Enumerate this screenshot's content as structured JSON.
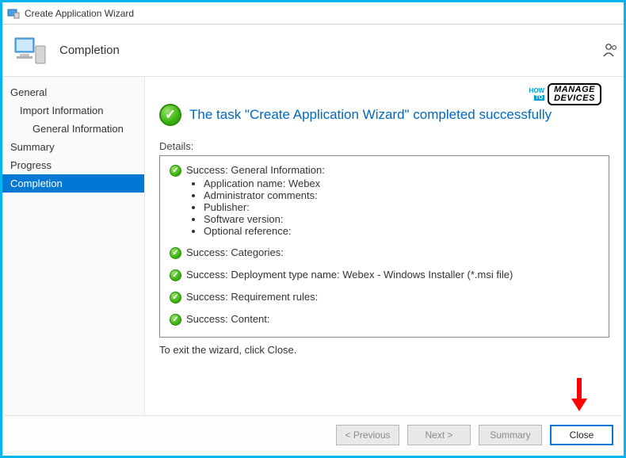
{
  "titlebar": {
    "title": "Create Application Wizard"
  },
  "header": {
    "title": "Completion"
  },
  "watermark": {
    "how": "HOW",
    "to": "TO",
    "brand": "MANAGE DEVICES"
  },
  "sidebar": {
    "items": [
      {
        "label": "General",
        "indent": 0
      },
      {
        "label": "Import Information",
        "indent": 1
      },
      {
        "label": "General Information",
        "indent": 2
      },
      {
        "label": "Summary",
        "indent": 0
      },
      {
        "label": "Progress",
        "indent": 0
      },
      {
        "label": "Completion",
        "indent": 0,
        "selected": true
      }
    ]
  },
  "status": {
    "message": "The task \"Create Application Wizard\" completed successfully"
  },
  "details": {
    "label": "Details:",
    "sections": [
      {
        "title": "Success: General Information:",
        "bullets": [
          "Application name: Webex",
          "Administrator comments:",
          "Publisher:",
          "Software version:",
          "Optional reference:"
        ]
      },
      {
        "title": "Success: Categories:"
      },
      {
        "title": "Success: Deployment type name: Webex - Windows Installer (*.msi file)"
      },
      {
        "title": "Success: Requirement rules:"
      },
      {
        "title": "Success: Content:"
      }
    ]
  },
  "exit_hint": "To exit the wizard, click Close.",
  "footer": {
    "previous": "< Previous",
    "next": "Next >",
    "summary": "Summary",
    "close": "Close"
  }
}
